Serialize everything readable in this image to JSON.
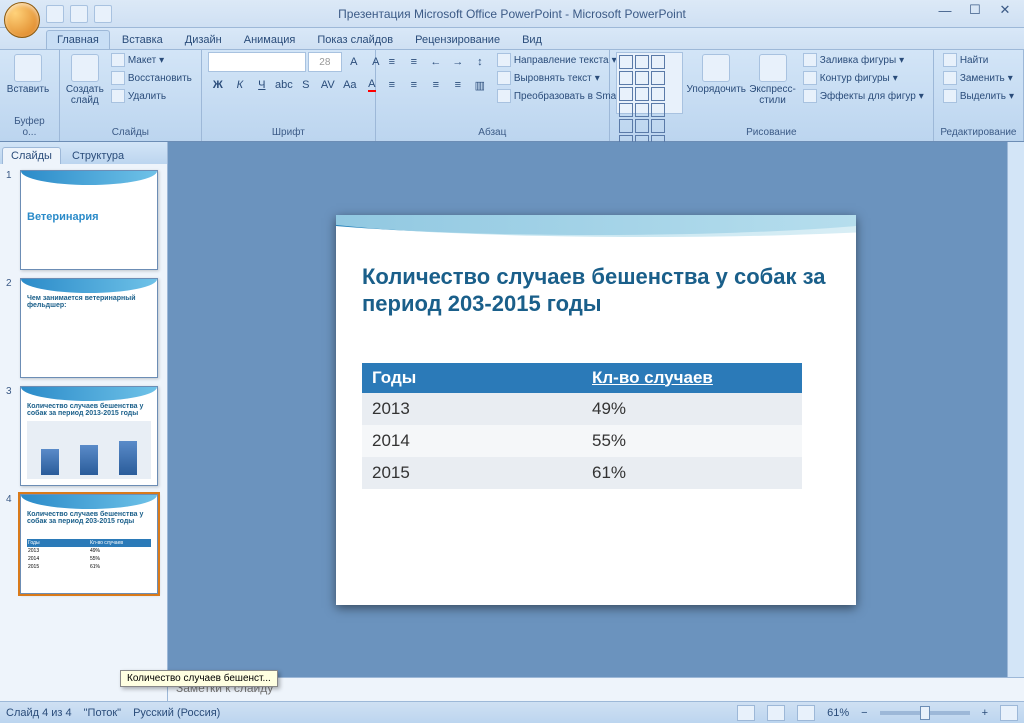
{
  "title": "Презентация Microsoft Office PowerPoint - Microsoft PowerPoint",
  "tabs": {
    "home": "Главная",
    "insert": "Вставка",
    "design": "Дизайн",
    "animation": "Анимация",
    "slideshow": "Показ слайдов",
    "review": "Рецензирование",
    "view": "Вид"
  },
  "groups": {
    "clipboard": "Буфер о...",
    "slides": "Слайды",
    "font": "Шрифт",
    "paragraph": "Абзац",
    "drawing": "Рисование",
    "editing": "Редактирование"
  },
  "ribbon": {
    "paste": "Вставить",
    "new_slide": "Создать\nслайд",
    "layout": "Макет",
    "reset": "Восстановить",
    "delete": "Удалить",
    "font_size": "28",
    "text_direction": "Направление текста",
    "align_text": "Выровнять текст",
    "convert_smartart": "Преобразовать в SmartArt",
    "arrange": "Упорядочить",
    "quick_styles": "Экспресс-стили",
    "shape_fill": "Заливка фигуры",
    "shape_outline": "Контур фигуры",
    "shape_effects": "Эффекты для фигур",
    "find": "Найти",
    "replace": "Заменить",
    "select": "Выделить"
  },
  "pane_tabs": {
    "slides": "Слайды",
    "outline": "Структура"
  },
  "thumbs": [
    {
      "title": "Ветеринария"
    },
    {
      "title": "Чем занимается ветеринарный фельдшер:"
    },
    {
      "title": "Количество случаев бешенства у собак за период 2013-2015 годы"
    },
    {
      "title": "Количество случаев бешенства у собак за период 203-2015 годы"
    }
  ],
  "tooltip": "Количество случаев бешенст...",
  "slide": {
    "title": "Количество случаев бешенства у собак за период 203-2015 годы",
    "headers": [
      "Годы",
      "Кл-во случаев"
    ],
    "rows": [
      [
        "2013",
        "49%"
      ],
      [
        "2014",
        "55%"
      ],
      [
        "2015",
        "61%"
      ]
    ]
  },
  "notes_placeholder": "Заметки к слайду",
  "status": {
    "slide_count": "Слайд 4 из 4",
    "theme": "\"Поток\"",
    "language": "Русский (Россия)",
    "zoom": "61%"
  },
  "chart_data": {
    "type": "table",
    "title": "Количество случаев бешенства у собак за период 203-2015 годы",
    "categories": [
      "2013",
      "2014",
      "2015"
    ],
    "values": [
      49,
      55,
      61
    ],
    "xlabel": "Годы",
    "ylabel": "Кл-во случаев"
  }
}
